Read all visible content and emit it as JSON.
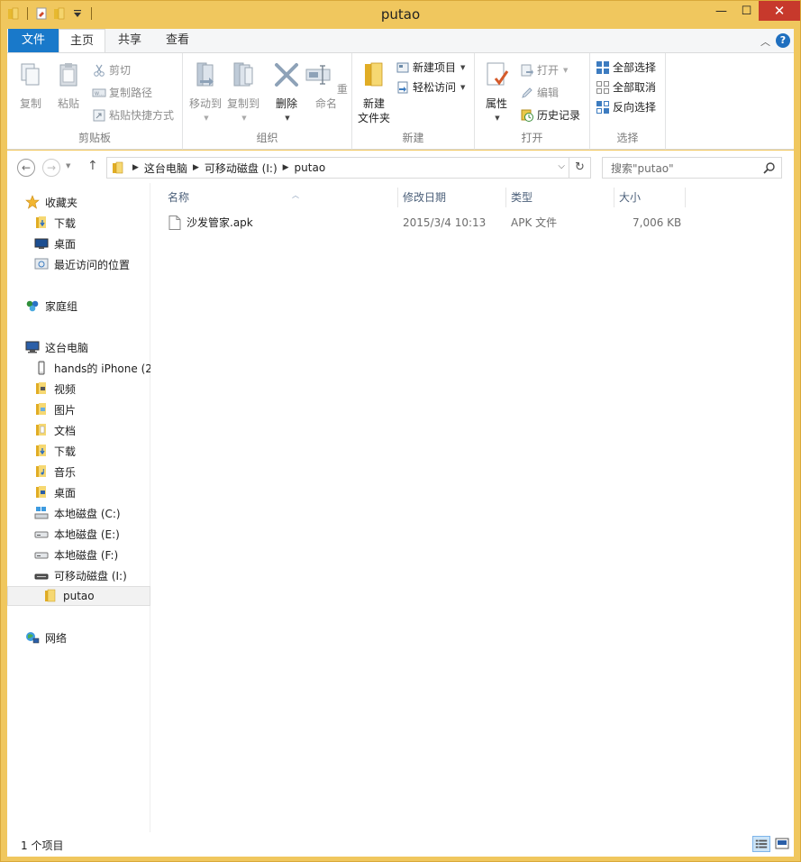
{
  "window": {
    "title": "putao",
    "minimize_glyph": "—",
    "maximize_glyph": "☐",
    "close_glyph": "✕"
  },
  "tabs": {
    "file": "文件",
    "home": "主页",
    "share": "共享",
    "view": "查看",
    "help": "?"
  },
  "ribbon": {
    "clipboard": {
      "label": "剪贴板",
      "copy": "复制",
      "paste": "粘贴",
      "cut": "剪切",
      "copy_path": "复制路径",
      "paste_shortcut": "粘贴快捷方式"
    },
    "organize": {
      "label": "组织",
      "move_to": "移动到",
      "copy_to": "复制到",
      "delete": "删除",
      "rename": "重命名"
    },
    "new": {
      "label": "新建",
      "new_folder_line1": "新建",
      "new_folder_line2": "文件夹",
      "new_item": "新建项目",
      "easy_access": "轻松访问"
    },
    "open": {
      "label": "打开",
      "properties": "属性",
      "open": "打开",
      "edit": "编辑",
      "history": "历史记录"
    },
    "select": {
      "label": "选择",
      "select_all": "全部选择",
      "select_none": "全部取消",
      "invert": "反向选择"
    }
  },
  "address": {
    "crumbs": [
      "这台电脑",
      "可移动磁盘 (I:)",
      "putao"
    ],
    "search_placeholder": "搜索\"putao\""
  },
  "nav": {
    "favorites": "收藏夹",
    "fav_downloads": "下载",
    "fav_desktop": "桌面",
    "fav_recent": "最近访问的位置",
    "homegroup": "家庭组",
    "this_pc": "这台电脑",
    "iphone": "hands的 iPhone (2",
    "videos": "视频",
    "pictures": "图片",
    "documents": "文档",
    "downloads": "下载",
    "music": "音乐",
    "desktop": "桌面",
    "drive_c": "本地磁盘 (C:)",
    "drive_e": "本地磁盘 (E:)",
    "drive_f": "本地磁盘 (F:)",
    "drive_i": "可移动磁盘 (I:)",
    "putao": "putao",
    "network": "网络"
  },
  "columns": {
    "name": "名称",
    "date": "修改日期",
    "type": "类型",
    "size": "大小"
  },
  "files": [
    {
      "name": "沙发管家.apk",
      "date": "2015/3/4 10:13",
      "type": "APK 文件",
      "size": "7,006 KB"
    }
  ],
  "status": {
    "count": "1 个项目"
  },
  "colors": {
    "frame": "#f0c75e",
    "file_tab": "#1979ca",
    "close": "#c7392c"
  }
}
